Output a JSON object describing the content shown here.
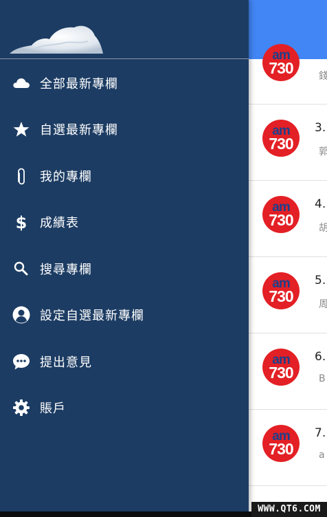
{
  "drawer": {
    "items": [
      {
        "label": "全部最新專欄",
        "icon": "cloud-icon"
      },
      {
        "label": "自選最新專欄",
        "icon": "star-icon"
      },
      {
        "label": "我的專欄",
        "icon": "paperclip-icon"
      },
      {
        "label": "成績表",
        "icon": "dollar-icon"
      },
      {
        "label": "搜尋專欄",
        "icon": "search-icon"
      },
      {
        "label": "設定自選最新專欄",
        "icon": "person-icon"
      },
      {
        "label": "提出意見",
        "icon": "chat-bubble-icon"
      },
      {
        "label": "賬戶",
        "icon": "gear-icon"
      }
    ]
  },
  "main": {
    "appbar_color": "#4285f4",
    "list": [
      {
        "logo_top": "am",
        "logo_bottom": "730",
        "title": "",
        "sub": "錢"
      },
      {
        "logo_top": "am",
        "logo_bottom": "730",
        "title": "3.",
        "sub": "郭"
      },
      {
        "logo_top": "am",
        "logo_bottom": "730",
        "title": "4.",
        "sub": "胡"
      },
      {
        "logo_top": "am",
        "logo_bottom": "730",
        "title": "5.",
        "sub": "周"
      },
      {
        "logo_top": "am",
        "logo_bottom": "730",
        "title": "6.",
        "sub": "B"
      },
      {
        "logo_top": "am",
        "logo_bottom": "730",
        "title": "7.",
        "sub": "a"
      }
    ]
  },
  "watermark": "WWW.QT6.COM",
  "colors": {
    "drawer_bg": "#1c3c63",
    "logo_red": "#e32025",
    "logo_blue": "#1f3f8a"
  }
}
